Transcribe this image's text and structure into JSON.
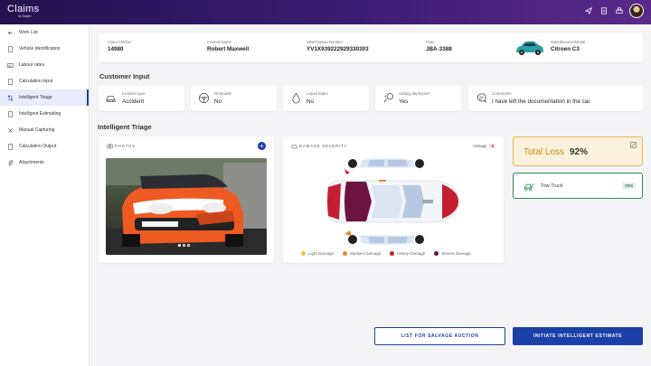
{
  "header": {
    "app_title": "Claims",
    "app_subtitle": "by Sapiel",
    "icons": [
      "send-icon",
      "document-icon",
      "printer-icon"
    ]
  },
  "sidebar": {
    "items": [
      {
        "label": "Work List",
        "icon": "back-arrow-icon"
      },
      {
        "label": "Vehicle Identification",
        "icon": "document-icon"
      },
      {
        "label": "Labour rates",
        "icon": "image-icon"
      },
      {
        "label": "Calculation Input",
        "icon": "document-icon"
      },
      {
        "label": "Intelligent Triage",
        "icon": "sort-icon",
        "active": true
      },
      {
        "label": "Intelligent Estimating",
        "icon": "document-icon"
      },
      {
        "label": "Manual Capturing",
        "icon": "tools-icon"
      },
      {
        "label": "Calculation Output",
        "icon": "document-icon"
      },
      {
        "label": "Attachments",
        "icon": "paperclip-icon"
      }
    ]
  },
  "claim": {
    "claim_number_label": "Claim number",
    "claim_number": "14980",
    "insured_label": "Insured Name",
    "insured": "Robert Maxwell",
    "vin_label": "VIN/Chassis Number",
    "vin": "YV1X939222929330303",
    "plate_label": "Plate",
    "plate": "JBA-3388",
    "model_label": "Manufacturer/Model",
    "model": "Citroen C3"
  },
  "customer_input": {
    "title": "Customer Input",
    "incident_label": "Incident type",
    "incident_value": "Accident",
    "driveable_label": "Driveable",
    "driveable_value": "No",
    "leaks_label": "Liquid leaks",
    "leaks_value": "No",
    "airbag_label": "Airbag deployed?",
    "airbag_value": "Yes",
    "comments_label": "Comments",
    "comments_value": "I have left the documentation in the car."
  },
  "triage": {
    "title": "Intelligent Triage",
    "photos_title": "PHOTOS",
    "damage_title": "DAMAGE SEVERITY",
    "airbags_label": "Airbags",
    "airbags_count": "2",
    "legend": [
      {
        "label": "Light Damage",
        "color": "#f2c23a"
      },
      {
        "label": "Medium Damage",
        "color": "#e8862a"
      },
      {
        "label": "Heavy Damage",
        "color": "#c41f30"
      },
      {
        "label": "Severe Damage",
        "color": "#6d1341"
      }
    ],
    "total_loss_label": "Total Loss",
    "total_loss_pct": "92%",
    "tow_label": "Tow Truck",
    "tow_badge": "YES"
  },
  "actions": {
    "salvage_label": "LIST FOR SALVAGE AUCTION",
    "estimate_label": "INITIATE INTELLIGENT ESTIMATE"
  },
  "colors": {
    "brand": "#1c3fa8",
    "header_start": "#23124f",
    "header_end": "#5a2a8a",
    "warning": "#e9b54a",
    "success": "#2e8b57"
  }
}
